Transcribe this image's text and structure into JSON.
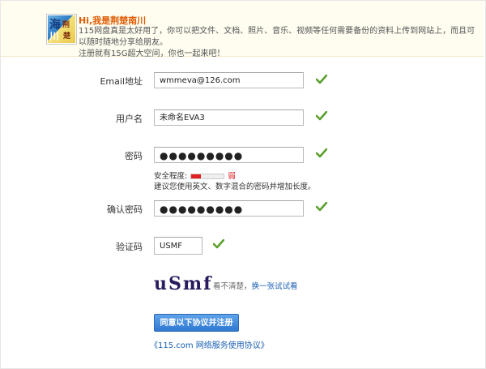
{
  "banner": {
    "greeting": "Hi,我是荆楚南川",
    "line1": "115网盘真是太好用了，你可以把文件、文档、照片、音乐、视频等任何需要备份的资料上传到网站上，而且可以随时随地分享给朋友。",
    "line2": "注册就有15G超大空间，你也一起来吧！",
    "avatar_text": [
      "海",
      "川",
      "荆",
      "楚"
    ]
  },
  "form": {
    "email_label": "Email地址",
    "email_value": "wmmeva@126.com",
    "username_label": "用户名",
    "username_value": "未命名EVA3",
    "password_label": "密码",
    "password_value": "●●●●●●●●●",
    "strength_label": "安全程度:",
    "strength_level": 0.3,
    "strength_word": "弱",
    "password_hint": "建议您使用英文、数字混合的密码并增加长度。",
    "confirm_label": "确认密码",
    "confirm_value": "●●●●●●●●●",
    "captcha_label": "验证码",
    "captcha_value": "USMF",
    "captcha_image_text": "uSmf",
    "captcha_unclear": "看不清楚，",
    "captcha_refresh": "换一张试试看",
    "submit_label": "同意以下协议并注册",
    "agreement_link": "《115.com 网络服务使用协议》"
  },
  "colors": {
    "check_green": "#5aa02c",
    "link_blue": "#1a5fb4",
    "greeting_orange": "#e05a00",
    "strength_red": "#e02020"
  },
  "icons": {
    "valid": "check-icon"
  }
}
